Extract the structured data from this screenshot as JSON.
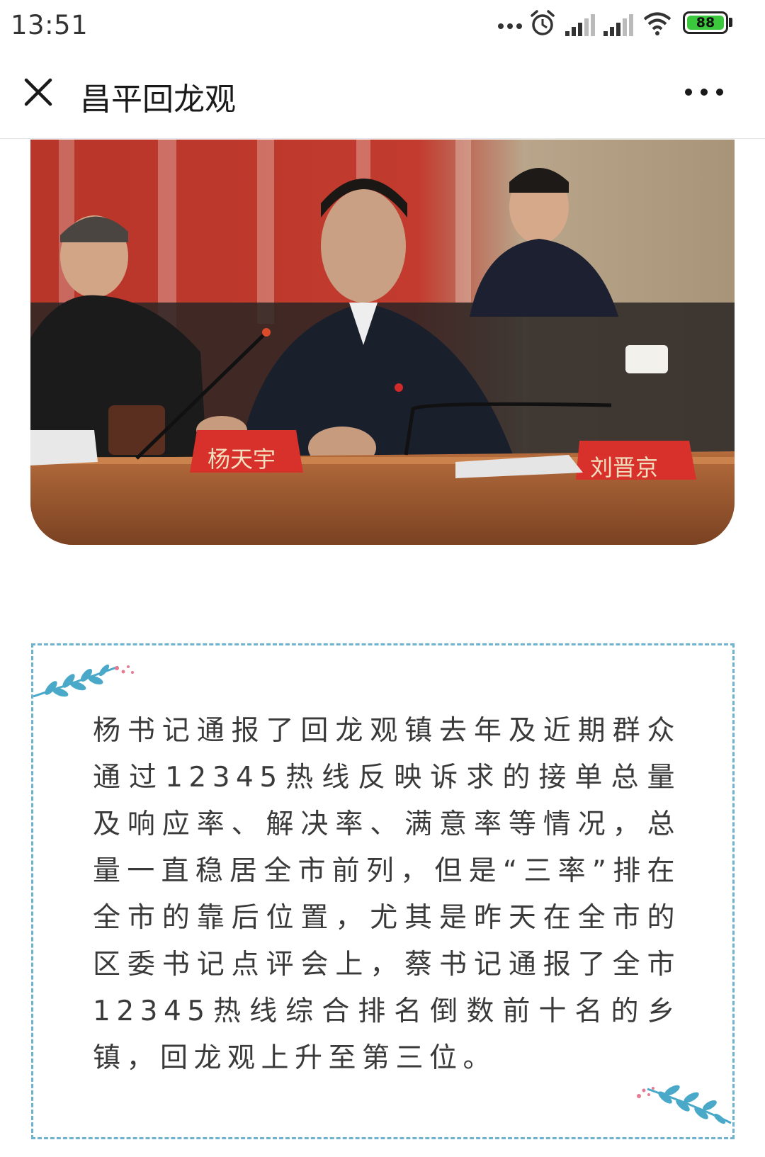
{
  "status_bar": {
    "time": "13:51",
    "battery_level": "88",
    "icons": [
      "more-dots-icon",
      "alarm-icon",
      "signal-icon",
      "signal-icon",
      "wifi-icon",
      "battery-icon"
    ],
    "battery_color": "#3cc83c"
  },
  "title_bar": {
    "title": "昌平回龙观",
    "close_icon": "close-icon",
    "more_icon": "more-icon"
  },
  "photo": {
    "name_card_left": "杨天宇",
    "name_card_right": "刘晋京"
  },
  "article": {
    "paragraph": "杨书记通报了回龙观镇去年及近期群众通过12345热线反映诉求的接单总量及响应率、解决率、满意率等情况，总量一直稳居全市前列，但是“三率”排在全市的靠后位置，尤其是昨天在全市的区委书记点评会上，蔡书记通报了全市12345热线综合排名倒数前十名的乡镇，回龙观上升至第三位。"
  },
  "colors": {
    "card_border": "#6fb2cf",
    "text": "#3a3a3a",
    "leaf": "#4aa9c8"
  }
}
